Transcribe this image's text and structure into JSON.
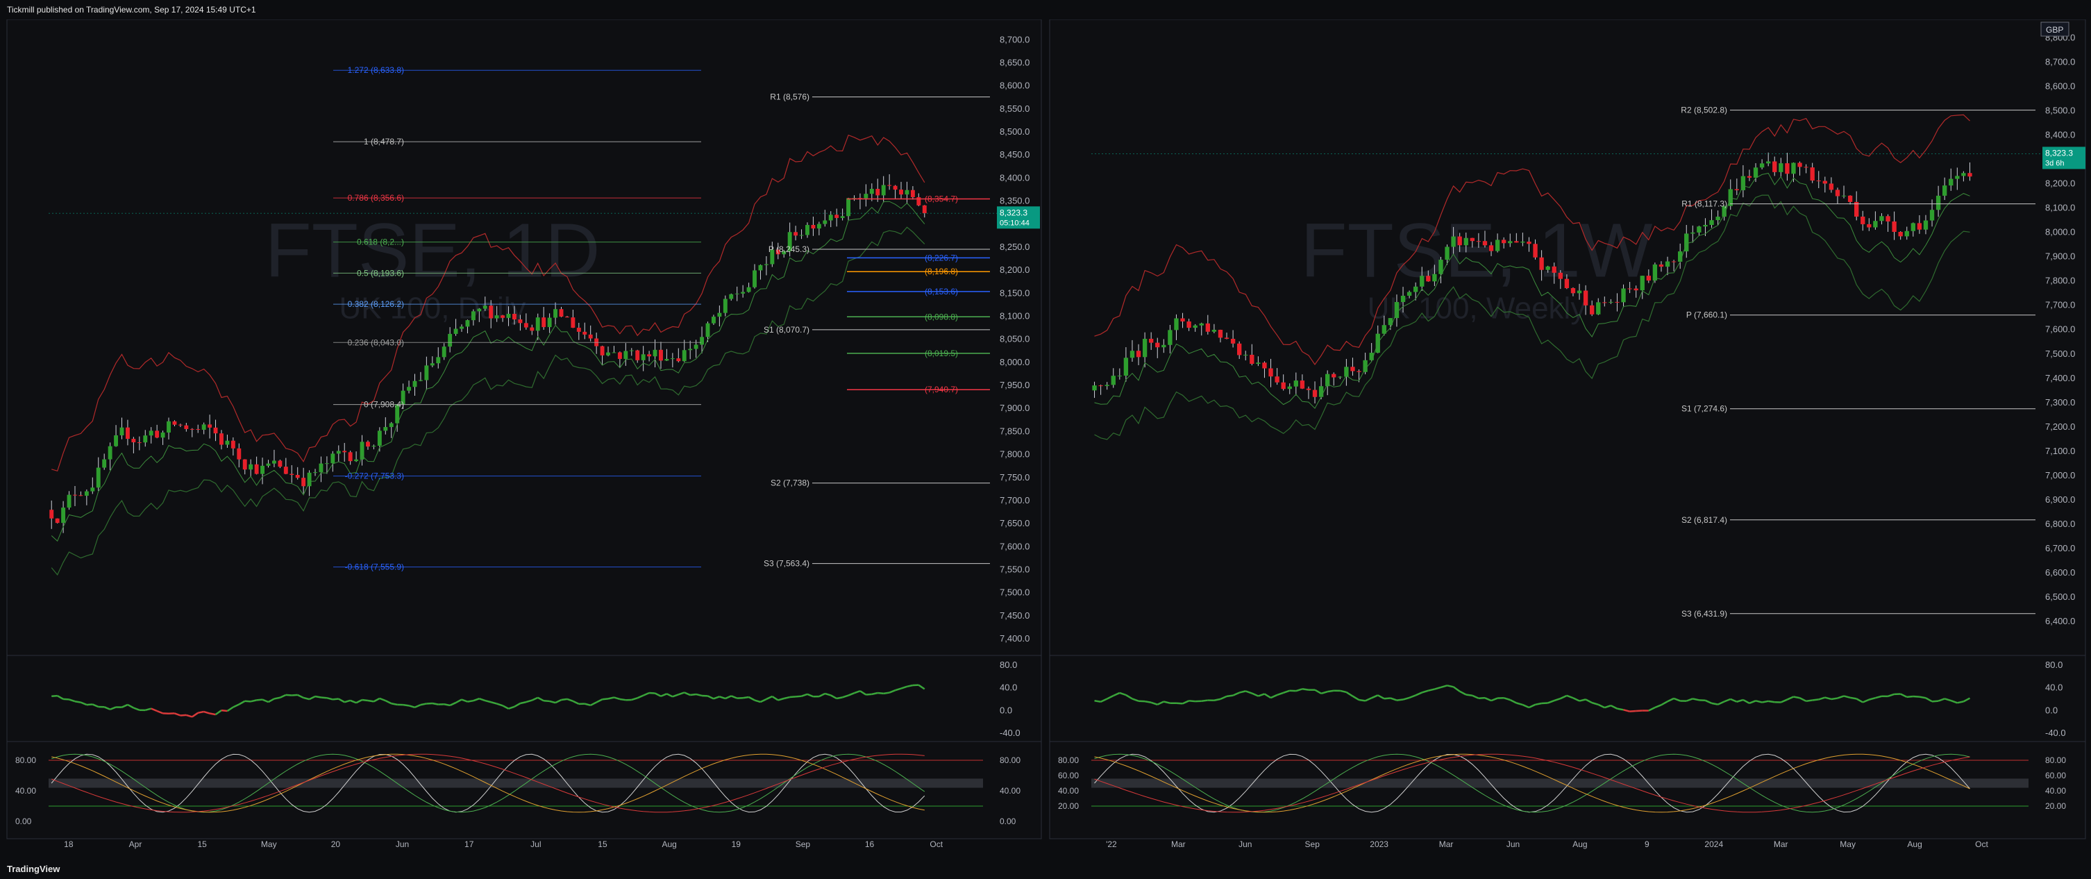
{
  "header": {
    "published": "Tickmill published on TradingView.com, Sep 17, 2024 15:49 UTC+1"
  },
  "footer": {
    "brand": "TradingView"
  },
  "chart_data": [
    {
      "type": "candlestick",
      "symbol_watermark": "FTSE, 1D",
      "subtitle_watermark": "UK 100, Daily",
      "price_ticks": [
        8700,
        8650,
        8600,
        8550,
        8500,
        8450,
        8400,
        8350,
        8300,
        8250,
        8200,
        8150,
        8100,
        8050,
        8000,
        7950,
        7900,
        7850,
        7800,
        7750,
        7700,
        7650,
        7600,
        7550,
        7500,
        7450,
        7400
      ],
      "price_labels": [
        "8,700.0",
        "8,650.0",
        "8,600.0",
        "8,550.0",
        "8,500.0",
        "8,450.0",
        "8,400.0",
        "8,350.0",
        "8,300.0",
        "8,250.0",
        "8,200.0",
        "8,150.0",
        "8,100.0",
        "8,050.0",
        "8,000.0",
        "7,950.0",
        "7,900.0",
        "7,850.0",
        "7,800.0",
        "7,750.0",
        "7,700.0",
        "7,650.0",
        "7,600.0",
        "7,550.0",
        "7,500.0",
        "7,450.0",
        "7,400.0"
      ],
      "ylim": [
        7385,
        8720
      ],
      "time_labels": [
        "18",
        "Apr",
        "15",
        "May",
        "20",
        "Jun",
        "17",
        "Jul",
        "15",
        "Aug",
        "19",
        "Sep",
        "16",
        "Oct"
      ],
      "last_price": {
        "value": 8323.3,
        "label": "8,323.3",
        "countdown": "05:10:44",
        "color": "#089981"
      },
      "fib_levels": [
        {
          "ratio": "1.272",
          "value": 8633.8,
          "label": "1.272 (8,633.8)",
          "color": "#2962ff"
        },
        {
          "ratio": "1",
          "value": 8478.7,
          "label": "1 (8,478.7)",
          "color": "#c0c0c0"
        },
        {
          "ratio": "0.786",
          "value": 8356.6,
          "label": "0.786 (8,356.6)",
          "color": "#f23645"
        },
        {
          "ratio": "0.618",
          "value": 8261,
          "label": "0.618 (8,2...)",
          "color": "#4caf50"
        },
        {
          "ratio": "0.5",
          "value": 8193.6,
          "label": "0.5 (8,193.6)",
          "color": "#81c784"
        },
        {
          "ratio": "0.382",
          "value": 8126.2,
          "label": "0.382 (8,126.2)",
          "color": "#5b9cf6"
        },
        {
          "ratio": "0.236",
          "value": 8043,
          "label": "0.236 (8,043.0)",
          "color": "#9e9e9e"
        },
        {
          "ratio": "0",
          "value": 7908.4,
          "label": "0 (7,908.4)",
          "color": "#c0c0c0"
        },
        {
          "ratio": "-0.272",
          "value": 7753.3,
          "label": "-0.272 (7,753.3)",
          "color": "#2962ff"
        },
        {
          "ratio": "-0.618",
          "value": 7555.9,
          "label": "-0.618 (7,555.9)",
          "color": "#2962ff"
        }
      ],
      "pivot_levels": [
        {
          "name": "R1",
          "value": 8576,
          "label": "R1 (8,576)"
        },
        {
          "name": "P",
          "value": 8245.3,
          "label": "P (8,245.3)"
        },
        {
          "name": "S1",
          "value": 8070.7,
          "label": "S1 (8,070.7)"
        },
        {
          "name": "S2",
          "value": 7738,
          "label": "S2 (7,738)"
        },
        {
          "name": "S3",
          "value": 7563.4,
          "label": "S3 (7,563.4)"
        }
      ],
      "zone_levels": [
        {
          "value": 8354.7,
          "label": "(8,354.7)",
          "color": "#f23645"
        },
        {
          "value": 8226.7,
          "label": "(8,226.7)",
          "color": "#2962ff"
        },
        {
          "value": 8196.8,
          "label": "(8,196.8)",
          "color": "#ff9800"
        },
        {
          "value": 8153.6,
          "label": "(8,153.6)",
          "color": "#2962ff"
        },
        {
          "value": 8098.8,
          "label": "(8,098.8)",
          "color": "#4caf50"
        },
        {
          "value": 8019.5,
          "label": "(8,019.5)",
          "color": "#4caf50"
        },
        {
          "value": 7940.7,
          "label": "(7,940.7)",
          "color": "#f23645"
        }
      ],
      "rsi": {
        "ticks": [
          80,
          40,
          0,
          -40
        ],
        "labels": [
          "80.0",
          "40.0",
          "0.0",
          "-40.0"
        ]
      },
      "stoch": {
        "ticks": [
          80,
          40,
          0
        ],
        "labels": [
          "80.00",
          "40.00",
          "0.00"
        ]
      }
    },
    {
      "type": "candlestick",
      "symbol_watermark": "FTSE, 1W",
      "subtitle_watermark": "UK 100, Weekly",
      "currency": "GBP",
      "price_ticks": [
        8800,
        8700,
        8600,
        8500,
        8400,
        8300,
        8200,
        8100,
        8000,
        7900,
        7800,
        7700,
        7600,
        7500,
        7400,
        7300,
        7200,
        7100,
        7000,
        6900,
        6800,
        6700,
        6600,
        6500,
        6400
      ],
      "price_labels": [
        "8,800.0",
        "8,700.0",
        "8,600.0",
        "8,500.0",
        "8,400.0",
        "8,300.0",
        "8,200.0",
        "8,100.0",
        "8,000.0",
        "7,900.0",
        "7,800.0",
        "7,700.0",
        "7,600.0",
        "7,500.0",
        "7,400.0",
        "7,300.0",
        "7,200.0",
        "7,100.0",
        "7,000.0",
        "6,900.0",
        "6,800.0",
        "6,700.0",
        "6,600.0",
        "6,500.0",
        "6,400.0"
      ],
      "ylim": [
        6300,
        8830
      ],
      "time_labels": [
        "'22",
        "Mar",
        "Jun",
        "Sep",
        "2023",
        "Mar",
        "Jun",
        "Aug",
        "9",
        "2024",
        "Mar",
        "May",
        "Aug",
        "Oct"
      ],
      "last_price": {
        "value": 8323.3,
        "label": "8,323.3",
        "countdown": "3d 6h",
        "color": "#089981"
      },
      "pivot_levels": [
        {
          "name": "R2",
          "value": 8502.8,
          "label": "R2 (8,502.8)"
        },
        {
          "name": "R1",
          "value": 8117.3,
          "label": "R1 (8,117.3)"
        },
        {
          "name": "P",
          "value": 7660.1,
          "label": "P (7,660.1)"
        },
        {
          "name": "S1",
          "value": 7274.6,
          "label": "S1 (7,274.6)"
        },
        {
          "name": "S2",
          "value": 6817.4,
          "label": "S2 (6,817.4)"
        },
        {
          "name": "S3",
          "value": 6431.9,
          "label": "S3 (6,431.9)"
        }
      ],
      "rsi": {
        "ticks": [
          80,
          40,
          0,
          -40
        ],
        "labels": [
          "80.0",
          "40.0",
          "0.0",
          "-40.0"
        ]
      },
      "stoch": {
        "ticks": [
          80,
          60,
          40,
          20
        ],
        "labels": [
          "80.00",
          "60.00",
          "40.00",
          "20.00"
        ]
      }
    }
  ]
}
